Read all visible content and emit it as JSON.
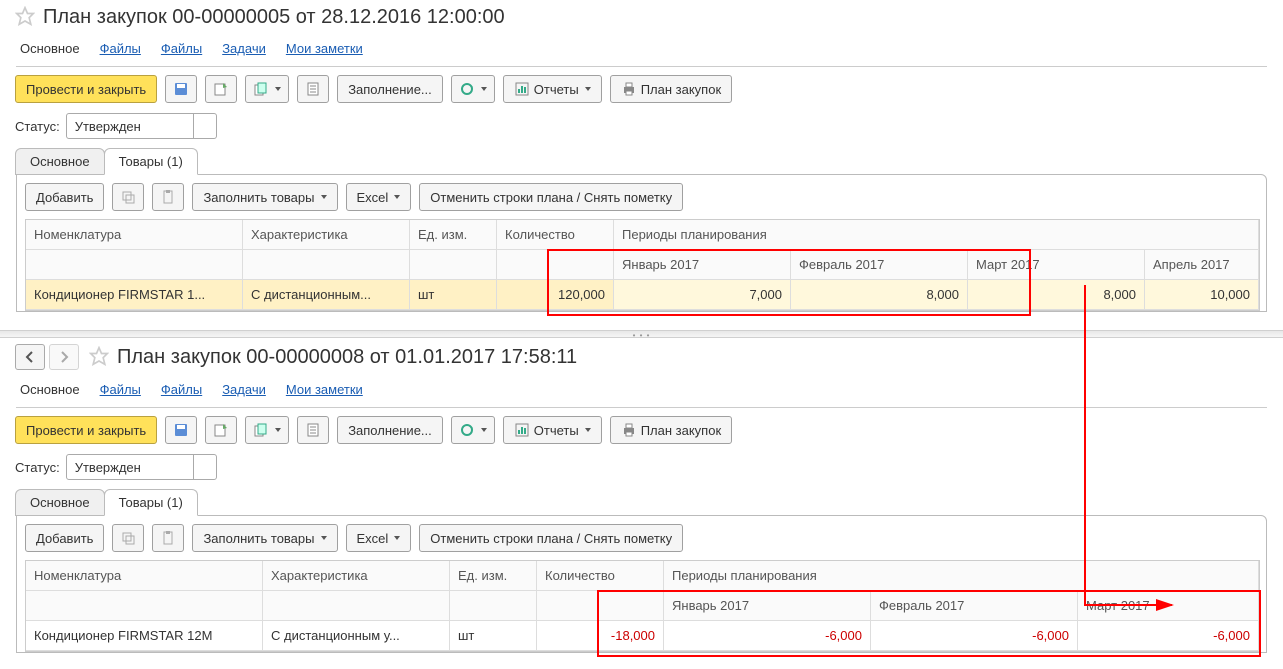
{
  "top": {
    "title": "План закупок 00-00000005 от 28.12.2016 12:00:00",
    "nav": {
      "main": "Основное",
      "files1": "Файлы",
      "files2": "Файлы",
      "tasks": "Задачи",
      "notes": "Мои заметки"
    },
    "toolbar": {
      "submit": "Провести и закрыть",
      "fill": "Заполнение...",
      "reports": "Отчеты",
      "plan": "План закупок"
    },
    "status_label": "Статус:",
    "status_value": "Утвержден",
    "tabs": {
      "main": "Основное",
      "goods": "Товары (1)"
    },
    "tab_toolbar": {
      "add": "Добавить",
      "fill_goods": "Заполнить товары",
      "excel": "Excel",
      "cancel": "Отменить строки плана / Снять пометку"
    },
    "headers": {
      "nom": "Номенклатура",
      "char": "Характеристика",
      "ed": "Ед. изм.",
      "qty": "Количество",
      "periods": "Периоды планирования",
      "m1": "Январь 2017",
      "m2": "Февраль 2017",
      "m3": "Март 2017",
      "m4": "Апрель 2017"
    },
    "row": {
      "nom": "Кондиционер FIRMSTAR 1...",
      "char": "С дистанционным...",
      "ed": "шт",
      "qty": "120,000",
      "m1": "7,000",
      "m2": "8,000",
      "m3": "8,000",
      "m4": "10,000"
    }
  },
  "bottom": {
    "title": "План закупок 00-00000008 от 01.01.2017 17:58:11",
    "nav": {
      "main": "Основное",
      "files1": "Файлы",
      "files2": "Файлы",
      "tasks": "Задачи",
      "notes": "Мои заметки"
    },
    "toolbar": {
      "submit": "Провести и закрыть",
      "fill": "Заполнение...",
      "reports": "Отчеты",
      "plan": "План закупок"
    },
    "status_label": "Статус:",
    "status_value": "Утвержден",
    "tabs": {
      "main": "Основное",
      "goods": "Товары (1)"
    },
    "tab_toolbar": {
      "add": "Добавить",
      "fill_goods": "Заполнить товары",
      "excel": "Excel",
      "cancel": "Отменить строки плана / Снять пометку"
    },
    "headers": {
      "nom": "Номенклатура",
      "char": "Характеристика",
      "ed": "Ед. изм.",
      "qty": "Количество",
      "periods": "Периоды планирования",
      "m1": "Январь 2017",
      "m2": "Февраль 2017",
      "m3": "Март 2017"
    },
    "row": {
      "nom": "Кондиционер FIRMSTAR 12M",
      "char": "С дистанционным у...",
      "ed": "шт",
      "qty": "-18,000",
      "m1": "-6,000",
      "m2": "-6,000",
      "m3": "-6,000"
    }
  }
}
